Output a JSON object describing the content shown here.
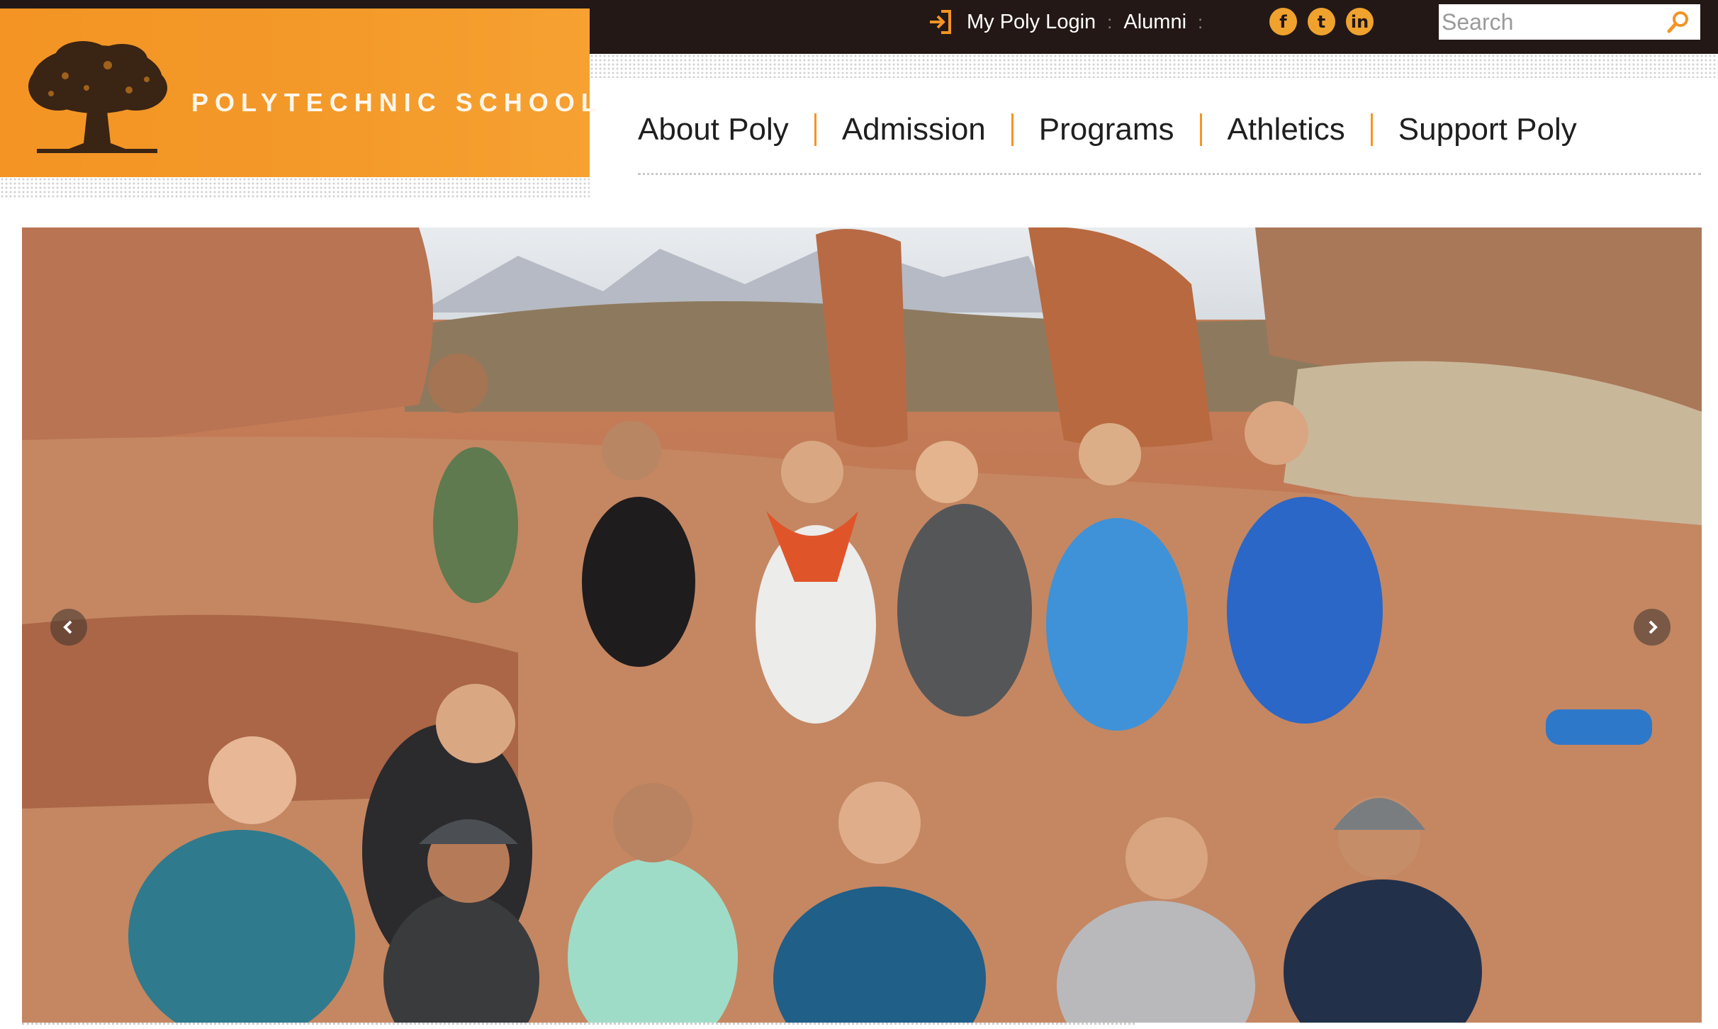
{
  "header": {
    "logo": {
      "name": "POLYTECHNIC SCHOOL",
      "brand_color": "#f39424",
      "icon": "oak-tree-logo"
    },
    "utility_nav": {
      "login_icon": "sign-in-icon",
      "login_label": "My Poly Login",
      "separator": ":",
      "alumni_label": "Alumni"
    },
    "social": [
      {
        "icon": "facebook-icon",
        "glyph": "f"
      },
      {
        "icon": "twitter-icon",
        "glyph": "t"
      },
      {
        "icon": "linkedin-icon",
        "glyph": "in"
      }
    ],
    "search": {
      "placeholder": "Search",
      "value": "",
      "icon": "search-icon"
    }
  },
  "main_nav": {
    "items": [
      "About Poly",
      "Admission",
      "Programs",
      "Athletics",
      "Support Poly"
    ],
    "divider_color": "#f39424"
  },
  "hero": {
    "image": "Group photo of students at a red-rock desert arch",
    "prev_icon": "chevron-left-icon",
    "next_icon": "chevron-right-icon"
  },
  "colors": {
    "topbar": "#231815",
    "accent": "#f39424"
  }
}
